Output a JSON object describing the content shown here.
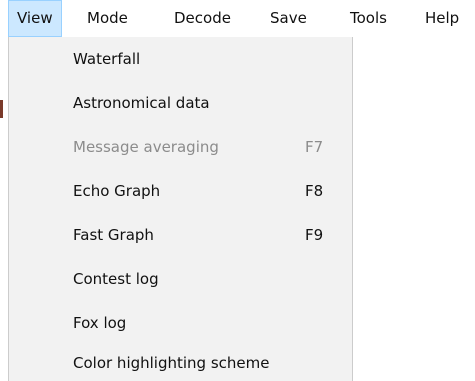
{
  "menubar": {
    "items": [
      {
        "label": "View"
      },
      {
        "label": "Mode"
      },
      {
        "label": "Decode"
      },
      {
        "label": "Save"
      },
      {
        "label": "Tools"
      },
      {
        "label": "Help"
      }
    ],
    "active_color": "#cce8ff"
  },
  "view_menu": {
    "items": [
      {
        "label": "Waterfall",
        "shortcut": "",
        "enabled": true
      },
      {
        "label": "Astronomical data",
        "shortcut": "",
        "enabled": true
      },
      {
        "label": "Message averaging",
        "shortcut": "F7",
        "enabled": false
      },
      {
        "label": "Echo Graph",
        "shortcut": "F8",
        "enabled": true
      },
      {
        "label": "Fast Graph",
        "shortcut": "F9",
        "enabled": true
      },
      {
        "label": "Contest log",
        "shortcut": "",
        "enabled": true
      },
      {
        "label": "Fox log",
        "shortcut": "",
        "enabled": true
      },
      {
        "label": "Color highlighting scheme",
        "shortcut": "",
        "enabled": true
      }
    ],
    "background_color": "#f2f2f2",
    "disabled_color": "#8c8c8c"
  }
}
